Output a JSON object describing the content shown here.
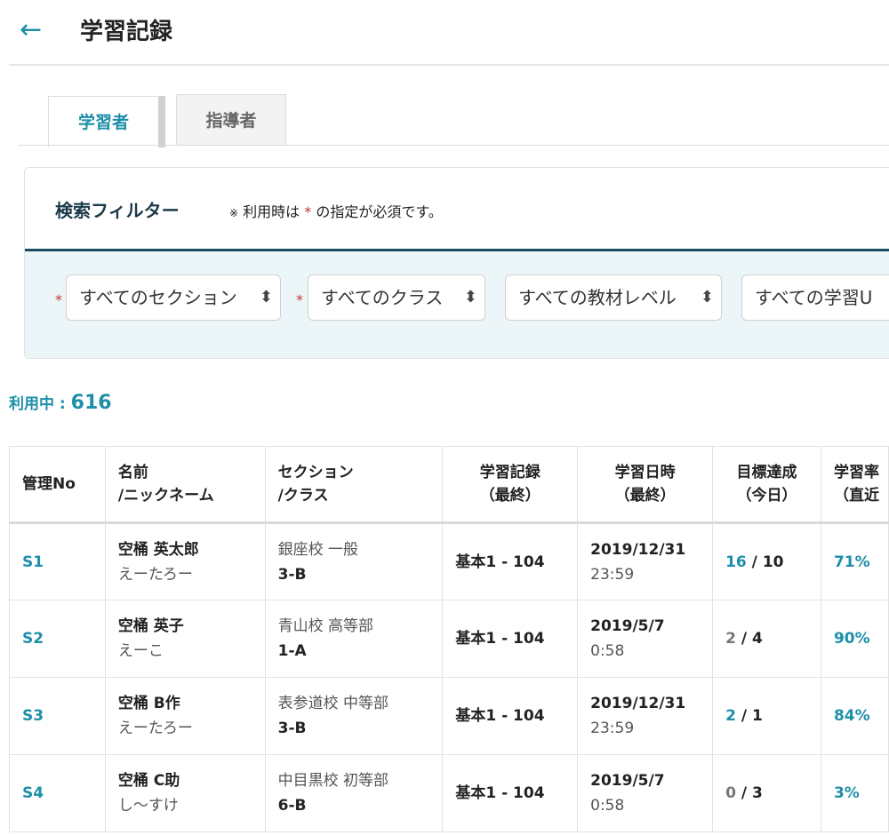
{
  "header": {
    "title": "学習記録"
  },
  "tabs": [
    {
      "label": "学習者",
      "active": true
    },
    {
      "label": "指導者",
      "active": false
    }
  ],
  "filter": {
    "title": "検索フィルター",
    "note_mark": "※",
    "note_pre": "利用時は",
    "note_star": "*",
    "note_post": "の指定が必須です。",
    "selects": [
      {
        "value": "すべてのセクション",
        "required": true
      },
      {
        "value": "すべてのクラス",
        "required": true
      },
      {
        "value": "すべての教材レベル",
        "required": false
      },
      {
        "value": "すべての学習U",
        "required": false
      }
    ]
  },
  "count": {
    "label": "利用中 :",
    "value": "616"
  },
  "table": {
    "headers": [
      [
        "管理No",
        ""
      ],
      [
        "名前",
        "/ニックネーム"
      ],
      [
        "セクション",
        "/クラス"
      ],
      [
        "学習記録",
        "（最終）"
      ],
      [
        "学習日時",
        "（最終）"
      ],
      [
        "目標達成",
        "（今日）"
      ],
      [
        "学習率",
        "（直近"
      ]
    ],
    "rows": [
      {
        "id": "S1",
        "name": "空桶 英太郎",
        "nick": "えーたろー",
        "section": "銀座校 一般",
        "class": "3-B",
        "record": "基本1 - 104",
        "date": "2019/12/31",
        "time": "23:59",
        "goal_done": "16",
        "goal_sep": " / ",
        "goal_target": "10",
        "goal_met": true,
        "rate": "71%"
      },
      {
        "id": "S2",
        "name": "空桶 英子",
        "nick": "えーこ",
        "section": "青山校 高等部",
        "class": "1-A",
        "record": "基本1 - 104",
        "date": "2019/5/7",
        "time": "0:58",
        "goal_done": "2",
        "goal_sep": " / ",
        "goal_target": "4",
        "goal_met": false,
        "rate": "90%"
      },
      {
        "id": "S3",
        "name": "空桶 B作",
        "nick": "えーたろー",
        "section": "表参道校 中等部",
        "class": "3-B",
        "record": "基本1 - 104",
        "date": "2019/12/31",
        "time": "23:59",
        "goal_done": "2",
        "goal_sep": " / ",
        "goal_target": "1",
        "goal_met": true,
        "rate": "84%"
      },
      {
        "id": "S4",
        "name": "空桶 C助",
        "nick": "し〜すけ",
        "section": "中目黒校 初等部",
        "class": "6-B",
        "record": "基本1 - 104",
        "date": "2019/5/7",
        "time": "0:58",
        "goal_done": "0",
        "goal_sep": " / ",
        "goal_target": "3",
        "goal_met": false,
        "rate": "3%"
      }
    ]
  }
}
